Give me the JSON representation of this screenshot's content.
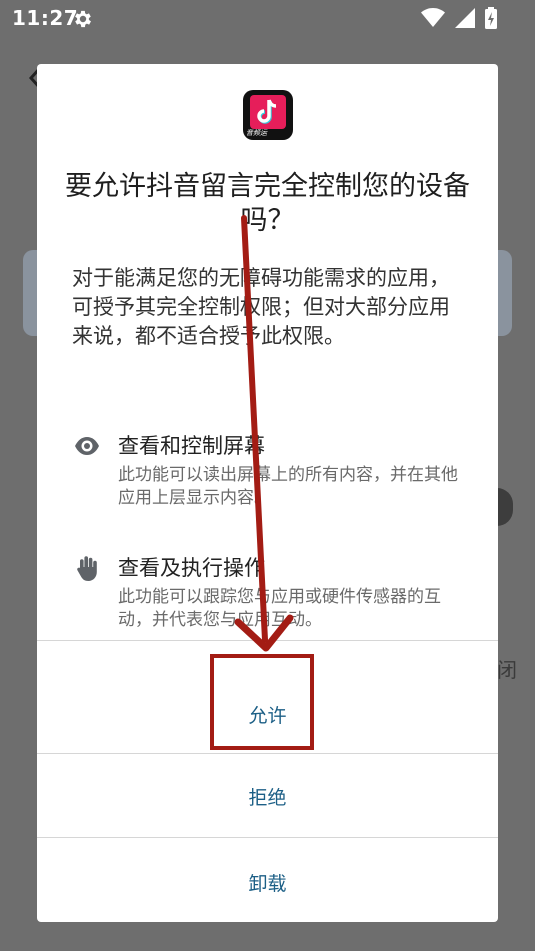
{
  "status_bar": {
    "time": "11:27"
  },
  "dialog": {
    "title": "要允许抖音留言完全控制您的设备吗？",
    "description": "对于能满足您的无障碍功能需求的应用，可授予其完全控制权限；但对大部分应用来说，都不适合授予此权限。",
    "app_icon_caption": "音频运",
    "permissions": [
      {
        "title": "查看和控制屏幕",
        "description": "此功能可以读出屏幕上的所有内容，并在其他应用上层显示内容。",
        "icon": "eye-icon"
      },
      {
        "title": "查看及执行操作",
        "description": "此功能可以跟踪您与应用或硬件传感器的互动，并代表您与应用互动。",
        "icon": "hand-icon"
      }
    ],
    "actions": {
      "allow": "允许",
      "deny": "拒绝",
      "uninstall": "卸载"
    }
  },
  "background": {
    "partial_char": "闭"
  },
  "colors": {
    "accent": "#1c5f86",
    "annotation": "#a31c14",
    "scrim": "#6e6e6e"
  }
}
